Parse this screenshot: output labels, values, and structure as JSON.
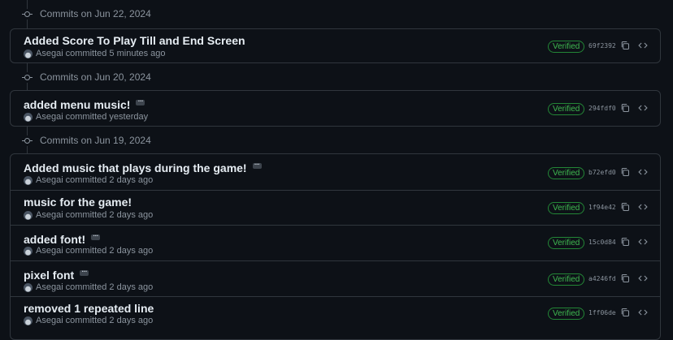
{
  "groups": [
    {
      "label": "Commits on Jun 22, 2024",
      "commits": [
        {
          "title": "Added Score To Play Till and End Screen",
          "has_more": false,
          "author": "Asegai",
          "time": "committed 5 minutes ago",
          "badge": "Verified",
          "sha": "69f2392"
        }
      ]
    },
    {
      "label": "Commits on Jun 20, 2024",
      "commits": [
        {
          "title": "added menu music!",
          "has_more": true,
          "author": "Asegai",
          "time": "committed yesterday",
          "badge": "Verified",
          "sha": "294fdf0"
        }
      ]
    },
    {
      "label": "Commits on Jun 19, 2024",
      "commits": [
        {
          "title": "Added music that plays during the game!",
          "has_more": true,
          "author": "Asegai",
          "time": "committed 2 days ago",
          "badge": "Verified",
          "sha": "b72efd0"
        },
        {
          "title": "music for the game!",
          "has_more": false,
          "author": "Asegai",
          "time": "committed 2 days ago",
          "badge": "Verified",
          "sha": "1f94e42"
        },
        {
          "title": "added font!",
          "has_more": true,
          "author": "Asegai",
          "time": "committed 2 days ago",
          "badge": "Verified",
          "sha": "15c0d84"
        },
        {
          "title": "pixel font",
          "has_more": true,
          "author": "Asegai",
          "time": "committed 2 days ago",
          "badge": "Verified",
          "sha": "a4246fd"
        },
        {
          "title": "removed 1 repeated line",
          "has_more": false,
          "author": "Asegai",
          "time": "committed 2 days ago",
          "badge": "Verified",
          "sha": "1ff06de"
        }
      ]
    }
  ],
  "icons": {
    "group": "git-commit-icon",
    "copy": "copy-icon",
    "browse": "code-icon",
    "more": "ellipsis-icon"
  },
  "colors": {
    "background": "#0d1117",
    "border": "#30363d",
    "verified": "#3fb950",
    "muted": "#8b949e",
    "text": "#e6edf3"
  }
}
